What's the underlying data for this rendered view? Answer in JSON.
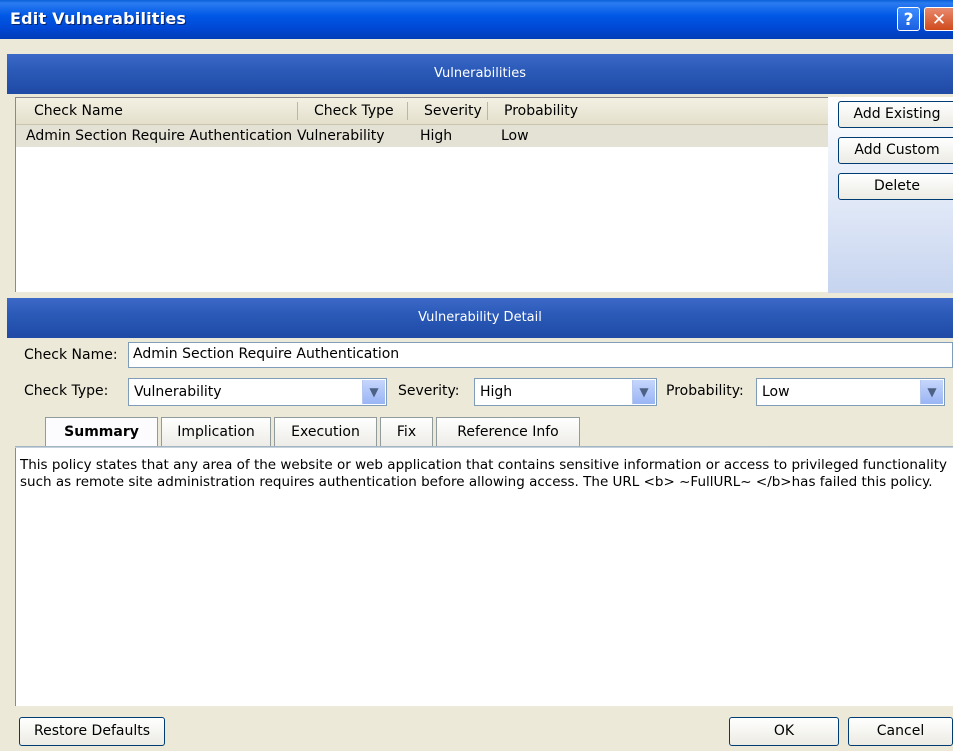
{
  "window": {
    "title": "Edit Vulnerabilities",
    "help_glyph": "?",
    "close_glyph": "✕"
  },
  "vulnerabilities": {
    "header": "Vulnerabilities",
    "columns": [
      "Check Name",
      "Check Type",
      "Severity",
      "Probability"
    ],
    "rows": [
      {
        "check_name": "Admin Section Require Authentication",
        "check_type": "Vulnerability",
        "severity": "High",
        "probability": "Low"
      }
    ],
    "buttons": {
      "add_existing": "Add Existing",
      "add_custom": "Add Custom",
      "delete": "Delete"
    }
  },
  "detail": {
    "header": "Vulnerability Detail",
    "check_name_label": "Check Name:",
    "check_name_value": "Admin Section Require Authentication",
    "check_type_label": "Check Type:",
    "check_type_value": "Vulnerability",
    "severity_label": "Severity:",
    "severity_value": "High",
    "probability_label": "Probability:",
    "probability_value": "Low",
    "tabs": [
      "Summary",
      "Implication",
      "Execution",
      "Fix",
      "Reference Info"
    ],
    "active_tab": "Summary",
    "summary_text": "This policy states that any area of the website or web application that contains sensitive information or access to privileged functionality such as remote site administration requires authentication before allowing access. The URL <b> ~FullURL~ </b>has failed this policy."
  },
  "footer": {
    "restore_defaults": "Restore Defaults",
    "ok": "OK",
    "cancel": "Cancel"
  },
  "icons": {
    "dropdown": "chevron-down-icon"
  }
}
